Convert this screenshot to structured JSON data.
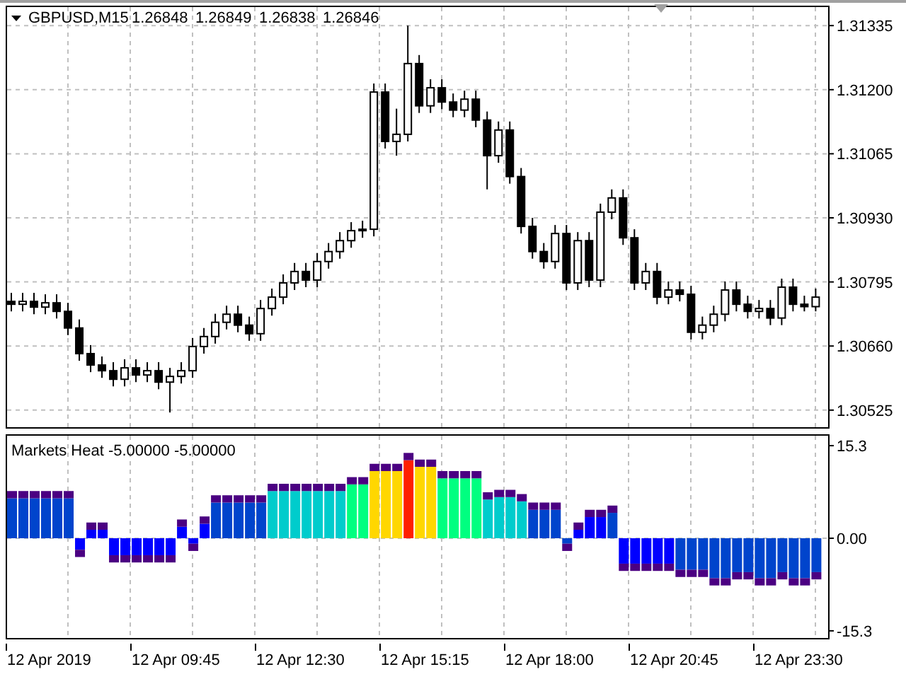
{
  "main_chart": {
    "symbol": "GBPUSD,M15",
    "quotes": [
      "1.26848",
      "1.26849",
      "1.26838",
      "1.26846"
    ],
    "chart_data": {
      "type": "candlestick",
      "categories": [
        null,
        null,
        null,
        null,
        null,
        null,
        null,
        null,
        null,
        null,
        null,
        null,
        null,
        null,
        null,
        null,
        null,
        null,
        null,
        null,
        null,
        null,
        null,
        null,
        null,
        null,
        null,
        null,
        null,
        null,
        null,
        null,
        null,
        null,
        null,
        null,
        null,
        null,
        null,
        null,
        null,
        null,
        null,
        null,
        null,
        null,
        null,
        null,
        null,
        null,
        null,
        null,
        null,
        null,
        null,
        null,
        null,
        null,
        null,
        null,
        null,
        null,
        null,
        null,
        null,
        null,
        null,
        null,
        null,
        null,
        null,
        null
      ],
      "grid": true,
      "ylim": [
        1.30489,
        1.31377
      ],
      "yticks": [
        {
          "value": 1.31335,
          "label": "1.31335"
        },
        {
          "value": 1.312,
          "label": "1.31200"
        },
        {
          "value": 1.31065,
          "label": "1.31065"
        },
        {
          "value": 1.3093,
          "label": "1.30930"
        },
        {
          "value": 1.30795,
          "label": "1.30795"
        },
        {
          "value": 1.3066,
          "label": "1.30660"
        },
        {
          "value": 1.30525,
          "label": "1.30525"
        }
      ],
      "ohlc": [
        [
          1.30754,
          1.30772,
          1.30733,
          1.30748
        ],
        [
          1.30748,
          1.30772,
          1.30733,
          1.30754
        ],
        [
          1.30754,
          1.30772,
          1.30727,
          1.30742
        ],
        [
          1.30742,
          1.30769,
          1.30727,
          1.30751
        ],
        [
          1.30751,
          1.30769,
          1.30718,
          1.30733
        ],
        [
          1.30733,
          1.30751,
          1.30683,
          1.30698
        ],
        [
          1.30698,
          1.30716,
          1.30629,
          1.30644
        ],
        [
          1.30644,
          1.30662,
          1.30605,
          1.3062
        ],
        [
          1.3062,
          1.30638,
          1.30593,
          1.30608
        ],
        [
          1.30608,
          1.30626,
          1.30575,
          1.3059
        ],
        [
          1.3059,
          1.30632,
          1.30575,
          1.30614
        ],
        [
          1.30614,
          1.30632,
          1.30584,
          1.30599
        ],
        [
          1.30599,
          1.30626,
          1.30584,
          1.30608
        ],
        [
          1.30608,
          1.30626,
          1.30569,
          1.30584
        ],
        [
          1.30584,
          1.30614,
          1.3052,
          1.30596
        ],
        [
          1.30596,
          1.30626,
          1.30581,
          1.30608
        ],
        [
          1.30608,
          1.30677,
          1.30593,
          1.30659
        ],
        [
          1.30659,
          1.30698,
          1.30644,
          1.3068
        ],
        [
          1.3068,
          1.30728,
          1.30665,
          1.3071
        ],
        [
          1.3071,
          1.30745,
          1.30695,
          1.30727
        ],
        [
          1.30727,
          1.30745,
          1.30689,
          1.30704
        ],
        [
          1.30704,
          1.30722,
          1.30671,
          1.30686
        ],
        [
          1.30686,
          1.30757,
          1.30671,
          1.30739
        ],
        [
          1.30739,
          1.30781,
          1.30724,
          1.30763
        ],
        [
          1.30763,
          1.30811,
          1.30748,
          1.30793
        ],
        [
          1.30793,
          1.30835,
          1.30778,
          1.30817
        ],
        [
          1.30817,
          1.30835,
          1.30784,
          1.30799
        ],
        [
          1.30799,
          1.30856,
          1.30784,
          1.30838
        ],
        [
          1.30838,
          1.30877,
          1.30823,
          1.30859
        ],
        [
          1.30859,
          1.309,
          1.30844,
          1.30882
        ],
        [
          1.30882,
          1.30921,
          1.30867,
          1.30903
        ],
        [
          1.30903,
          1.30924,
          1.30888,
          1.30906
        ],
        [
          1.30906,
          1.31213,
          1.30891,
          1.31195
        ],
        [
          1.31195,
          1.31213,
          1.31076,
          1.31091
        ],
        [
          1.31091,
          1.3116,
          1.31061,
          1.31106
        ],
        [
          1.31106,
          1.31335,
          1.31091,
          1.31255
        ],
        [
          1.31255,
          1.31273,
          1.31151,
          1.31166
        ],
        [
          1.31166,
          1.31222,
          1.31151,
          1.31204
        ],
        [
          1.31204,
          1.31222,
          1.31159,
          1.31174
        ],
        [
          1.31174,
          1.31192,
          1.31142,
          1.31157
        ],
        [
          1.31157,
          1.31198,
          1.31142,
          1.3118
        ],
        [
          1.3118,
          1.31198,
          1.31121,
          1.31136
        ],
        [
          1.31136,
          1.31154,
          1.3099,
          1.31061
        ],
        [
          1.31061,
          1.31133,
          1.31046,
          1.31115
        ],
        [
          1.31115,
          1.31133,
          1.31002,
          1.31017
        ],
        [
          1.31017,
          1.31035,
          1.30897,
          1.30912
        ],
        [
          1.30912,
          1.3093,
          1.30844,
          1.30859
        ],
        [
          1.30859,
          1.30877,
          1.30823,
          1.30838
        ],
        [
          1.30838,
          1.30915,
          1.30823,
          1.30897
        ],
        [
          1.30897,
          1.30915,
          1.30778,
          1.30793
        ],
        [
          1.30793,
          1.309,
          1.30778,
          1.30882
        ],
        [
          1.30882,
          1.309,
          1.30784,
          1.30799
        ],
        [
          1.30799,
          1.3096,
          1.30784,
          1.30942
        ],
        [
          1.30942,
          1.3099,
          1.30927,
          1.30972
        ],
        [
          1.30972,
          1.3099,
          1.30873,
          1.30888
        ],
        [
          1.30888,
          1.30906,
          1.30778,
          1.30793
        ],
        [
          1.30793,
          1.30835,
          1.30778,
          1.30817
        ],
        [
          1.30817,
          1.30835,
          1.30748,
          1.30763
        ],
        [
          1.30763,
          1.30796,
          1.30748,
          1.30778
        ],
        [
          1.30778,
          1.30796,
          1.30754,
          1.30769
        ],
        [
          1.30769,
          1.30787,
          1.30674,
          1.30689
        ],
        [
          1.30689,
          1.30722,
          1.30674,
          1.30704
        ],
        [
          1.30704,
          1.30745,
          1.30689,
          1.30727
        ],
        [
          1.30727,
          1.30796,
          1.30712,
          1.30778
        ],
        [
          1.30778,
          1.30796,
          1.30733,
          1.30748
        ],
        [
          1.30748,
          1.30766,
          1.30718,
          1.30733
        ],
        [
          1.30733,
          1.30757,
          1.30718,
          1.30739
        ],
        [
          1.30739,
          1.30757,
          1.30704,
          1.30719
        ],
        [
          1.30719,
          1.30802,
          1.30704,
          1.30784
        ],
        [
          1.30784,
          1.30802,
          1.30733,
          1.30748
        ],
        [
          1.30748,
          1.30766,
          1.30733,
          1.30743
        ],
        [
          1.30743,
          1.30781,
          1.30733,
          1.30763
        ]
      ]
    }
  },
  "indicator": {
    "title": "Markets Heat -5.00000 -5.00000",
    "chart_data": {
      "type": "bar",
      "stacked": true,
      "grid": true,
      "ylim": [
        -16.48,
        17.18
      ],
      "categories": [
        null,
        null,
        null,
        null,
        null,
        null,
        null,
        null,
        null,
        null,
        null,
        null,
        null,
        null,
        null,
        null,
        null,
        null,
        null,
        null,
        null,
        null,
        null,
        null,
        null,
        null,
        null,
        null,
        null,
        null,
        null,
        null,
        null,
        null,
        null,
        null,
        null,
        null,
        null,
        null,
        null,
        null,
        null,
        null,
        null,
        null,
        null,
        null,
        null,
        null,
        null,
        null,
        null,
        null,
        null,
        null,
        null,
        null,
        null,
        null,
        null,
        null,
        null,
        null,
        null,
        null,
        null,
        null,
        null,
        null,
        null,
        null
      ],
      "yticks": [
        {
          "value": 15.3,
          "label": "15.3"
        },
        {
          "value": 0,
          "label": "0.00"
        },
        {
          "value": -15.3,
          "label": "-15.3"
        }
      ],
      "series": [
        {
          "color": "#0044cc",
          "values": [
            6.6,
            6.6,
            6.6,
            6.6,
            6.6,
            6.6,
            null,
            null,
            null,
            null,
            null,
            null,
            null,
            null,
            null,
            null,
            null,
            null,
            5.9,
            5.9,
            5.9,
            5.9,
            5.9,
            null,
            null,
            null,
            null,
            null,
            null,
            null,
            null,
            null,
            null,
            null,
            null,
            null,
            null,
            null,
            null,
            null,
            null,
            null,
            null,
            null,
            null,
            null,
            4.7,
            4.7,
            4.7,
            -0.9,
            null,
            null,
            null,
            4.2,
            null,
            null,
            null,
            null,
            null,
            -5.2,
            -5.2,
            -5.2,
            -6.6,
            -6.6,
            -5.6,
            -5.6,
            -6.6,
            -6.6,
            -5.6,
            -6.6,
            -6.6,
            -5.6
          ]
        },
        {
          "color": "#0000ff",
          "values": [
            null,
            null,
            null,
            null,
            null,
            null,
            -1.9,
            1.4,
            1.4,
            -2.8,
            -2.8,
            -2.8,
            -2.8,
            -2.8,
            -2.8,
            1.9,
            -0.9,
            2.4,
            null,
            null,
            null,
            null,
            null,
            null,
            null,
            null,
            null,
            null,
            null,
            null,
            null,
            null,
            null,
            null,
            null,
            null,
            null,
            null,
            null,
            null,
            null,
            null,
            null,
            null,
            null,
            null,
            null,
            null,
            null,
            null,
            1.4,
            3.5,
            3.5,
            null,
            -4.2,
            -4.2,
            -4.2,
            -4.2,
            -4.2,
            null,
            null,
            null,
            null,
            null,
            null,
            null,
            null,
            null,
            null,
            null,
            null,
            null
          ]
        },
        {
          "color": "#00cccc",
          "values": [
            null,
            null,
            null,
            null,
            null,
            null,
            null,
            null,
            null,
            null,
            null,
            null,
            null,
            null,
            null,
            null,
            null,
            null,
            null,
            null,
            null,
            null,
            null,
            7.8,
            7.8,
            7.8,
            7.8,
            7.8,
            7.8,
            7.8,
            null,
            null,
            null,
            null,
            null,
            null,
            null,
            null,
            null,
            null,
            null,
            null,
            6.4,
            6.8,
            6.8,
            6.1,
            null,
            null,
            null,
            null,
            null,
            null,
            null,
            null,
            null,
            null,
            null,
            null,
            null,
            null,
            null,
            null,
            null,
            null,
            null,
            null,
            null,
            null,
            null,
            null,
            null,
            null
          ]
        },
        {
          "color": "#00ff80",
          "values": [
            null,
            null,
            null,
            null,
            null,
            null,
            null,
            null,
            null,
            null,
            null,
            null,
            null,
            null,
            null,
            null,
            null,
            null,
            null,
            null,
            null,
            null,
            null,
            null,
            null,
            null,
            null,
            null,
            null,
            null,
            8.9,
            8.9,
            null,
            null,
            null,
            null,
            null,
            null,
            9.9,
            9.9,
            9.9,
            9.9,
            null,
            null,
            null,
            null,
            null,
            null,
            null,
            null,
            null,
            null,
            null,
            null,
            null,
            null,
            null,
            null,
            null,
            null,
            null,
            null,
            null,
            null,
            null,
            null,
            null,
            null,
            null,
            null,
            null,
            null
          ]
        },
        {
          "color": "#ffd700",
          "values": [
            null,
            null,
            null,
            null,
            null,
            null,
            null,
            null,
            null,
            null,
            null,
            null,
            null,
            null,
            null,
            null,
            null,
            null,
            null,
            null,
            null,
            null,
            null,
            null,
            null,
            null,
            null,
            null,
            null,
            null,
            null,
            null,
            11.1,
            11.1,
            11.1,
            null,
            11.8,
            11.8,
            null,
            null,
            null,
            null,
            null,
            null,
            null,
            null,
            null,
            null,
            null,
            null,
            null,
            null,
            null,
            null,
            null,
            null,
            null,
            null,
            null,
            null,
            null,
            null,
            null,
            null,
            null,
            null,
            null,
            null,
            null,
            null,
            null,
            null
          ]
        },
        {
          "color": "#ff2000",
          "values": [
            null,
            null,
            null,
            null,
            null,
            null,
            null,
            null,
            null,
            null,
            null,
            null,
            null,
            null,
            null,
            null,
            null,
            null,
            null,
            null,
            null,
            null,
            null,
            null,
            null,
            null,
            null,
            null,
            null,
            null,
            null,
            null,
            null,
            null,
            null,
            12.9,
            null,
            null,
            null,
            null,
            null,
            null,
            null,
            null,
            null,
            null,
            null,
            null,
            null,
            null,
            null,
            null,
            null,
            null,
            null,
            null,
            null,
            null,
            null,
            null,
            null,
            null,
            null,
            null,
            null,
            null,
            null,
            null,
            null,
            null,
            null,
            null
          ]
        },
        {
          "color": "#4b0082",
          "values": [
            1.2,
            1.2,
            1.2,
            1.2,
            1.2,
            1.2,
            -1.2,
            1.2,
            1.2,
            -1.2,
            -1.2,
            -1.2,
            -1.2,
            -1.2,
            -1.2,
            1.2,
            -1.2,
            1.2,
            1.2,
            1.2,
            1.2,
            1.2,
            1.2,
            1.2,
            1.2,
            1.2,
            1.2,
            1.2,
            1.2,
            1.2,
            1.2,
            1.2,
            1.2,
            1.2,
            1.2,
            1.2,
            1.2,
            1.2,
            1.2,
            1.2,
            1.2,
            1.2,
            1.2,
            1.2,
            1.2,
            1.2,
            1.2,
            1.2,
            1.2,
            -1.2,
            1.2,
            1.2,
            1.2,
            1.2,
            -1.2,
            -1.2,
            -1.2,
            -1.2,
            -1.2,
            -1.2,
            -1.2,
            -1.2,
            -1.2,
            -1.2,
            -1.2,
            -1.2,
            -1.2,
            -1.2,
            -1.2,
            -1.2,
            -1.2,
            -1.2
          ]
        }
      ]
    }
  },
  "time_axis": [
    "12 Apr 2019",
    "12 Apr 09:45",
    "12 Apr 12:30",
    "12 Apr 15:15",
    "12 Apr 18:00",
    "12 Apr 20:45",
    "12 Apr 23:30"
  ]
}
